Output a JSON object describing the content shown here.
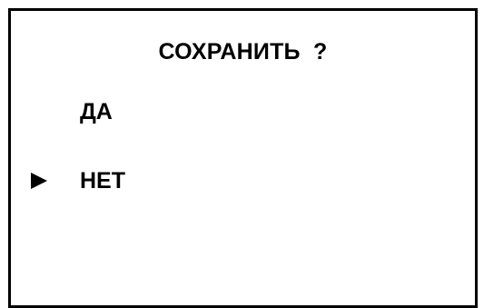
{
  "dialog": {
    "title": "СОХРАНИТЬ  ?",
    "options": [
      {
        "label": "ДА",
        "selected": false
      },
      {
        "label": "НЕТ",
        "selected": true
      }
    ],
    "selector_icon": "right-triangle-pointer-icon"
  }
}
